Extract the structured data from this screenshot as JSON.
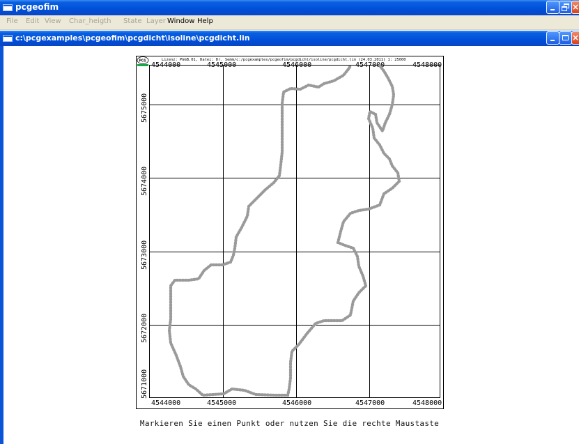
{
  "app": {
    "title": "pcgeofim"
  },
  "menu": [
    "File",
    "Edit",
    "View",
    "Char_heigth",
    "State",
    "Layer",
    "Window",
    "Help"
  ],
  "document": {
    "title": "c:\\pcgexamples\\pcgeofim\\pcgdicht\\isoline\\pcgdicht.lin"
  },
  "map": {
    "header": "Lizenz: PGGB.01, Datei: Dr. Semm/c:/pcgexamples/pcgeofim/pcgdicht/isoline/pcgdicht.lin (24.03.2011) 1: 25000",
    "logo_text": "PCG",
    "x_ticks": [
      "4544000",
      "4545000",
      "4546000",
      "4547000",
      "4548000"
    ],
    "y_ticks": [
      "5675000",
      "5674000",
      "5673000",
      "5672000",
      "5671000"
    ]
  },
  "status_text": "Markieren Sie einen Punkt oder nutzen Sie die rechte Maustaste"
}
